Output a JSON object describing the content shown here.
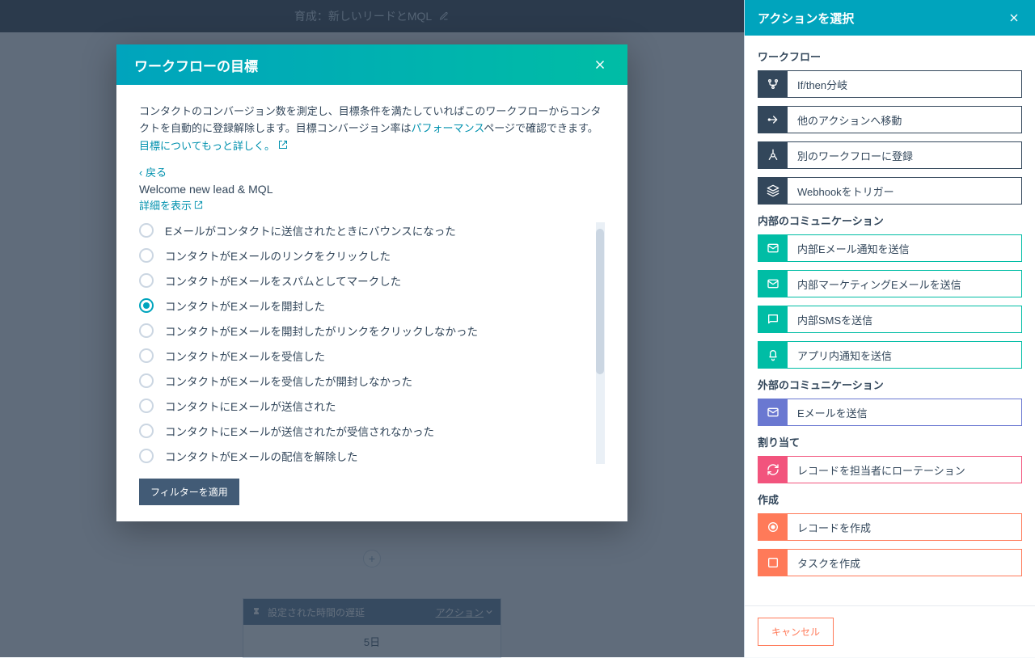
{
  "topbar": {
    "title": "育成：新しいリードとMQL"
  },
  "modal": {
    "header": "ワークフローの目標",
    "desc_part1": "コンタクトのコンバージョン数を測定し、目標条件を満たしていればこのワークフローからコンタクトを自動的に登録解除します。目標コンバージョン率は",
    "desc_link": "パフォーマンス",
    "desc_part2": "ページで確認できます。",
    "learn_more": "目標についてもっと詳しく。",
    "back": "‹ 戻る",
    "workflow_name": "Welcome new lead & MQL",
    "show_details": "詳細を表示",
    "options": [
      "Eメールがコンタクトに送信されたときにバウンスになった",
      "コンタクトがEメールのリンクをクリックした",
      "コンタクトがEメールをスパムとしてマークした",
      "コンタクトがEメールを開封した",
      "コンタクトがEメールを開封したがリンクをクリックしなかった",
      "コンタクトがEメールを受信した",
      "コンタクトがEメールを受信したが開封しなかった",
      "コンタクトにEメールが送信された",
      "コンタクトにEメールが送信されたが受信されなかった",
      "コンタクトがEメールの配信を解除した"
    ],
    "selected_index": 3,
    "apply_filter": "フィルターを適用"
  },
  "canvas": {
    "delay_header": "設定された時間の遅延",
    "delay_actions": "アクション",
    "delay_value": "5日"
  },
  "right_panel": {
    "header": "アクションを選択",
    "sections": [
      {
        "title": "ワークフロー",
        "items": [
          {
            "label": "If/then分岐",
            "color": "teal-dark",
            "icon": "branch"
          },
          {
            "label": "他のアクションへ移動",
            "color": "teal-dark",
            "icon": "goto"
          },
          {
            "label": "別のワークフローに登録",
            "color": "teal-dark",
            "icon": "enroll"
          },
          {
            "label": "Webhookをトリガー",
            "color": "teal-dark",
            "icon": "webhook"
          }
        ]
      },
      {
        "title": "内部のコミュニケーション",
        "items": [
          {
            "label": "内部Eメール通知を送信",
            "color": "teal",
            "icon": "mail"
          },
          {
            "label": "内部マーケティングEメールを送信",
            "color": "teal",
            "icon": "mail"
          },
          {
            "label": "内部SMSを送信",
            "color": "teal",
            "icon": "sms"
          },
          {
            "label": "アプリ内通知を送信",
            "color": "teal",
            "icon": "bell"
          }
        ]
      },
      {
        "title": "外部のコミュニケーション",
        "border": "purple",
        "items": [
          {
            "label": "Eメールを送信",
            "color": "purple",
            "icon": "mail"
          }
        ]
      },
      {
        "title": "割り当て",
        "border": "pink",
        "items": [
          {
            "label": "レコードを担当者にローテーション",
            "color": "pink",
            "icon": "rotate"
          }
        ]
      },
      {
        "title": "作成",
        "border": "orange",
        "items": [
          {
            "label": "レコードを作成",
            "color": "orange",
            "icon": "record"
          },
          {
            "label": "タスクを作成",
            "color": "orange",
            "icon": "task"
          }
        ]
      }
    ],
    "cancel": "キャンセル"
  }
}
